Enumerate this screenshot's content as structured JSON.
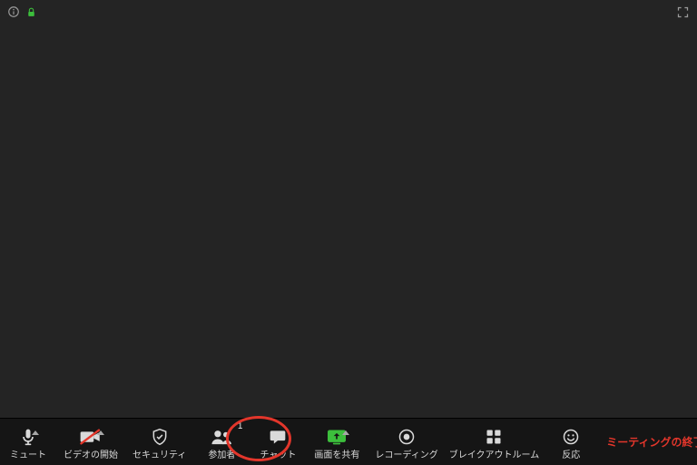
{
  "colors": {
    "accent_green": "#3cbf3c",
    "danger_red": "#e3362b",
    "icon_gray": "#d9d9d9",
    "icon_dim": "#9b9b9b"
  },
  "top": {
    "info_icon": "info-icon",
    "encryption_icon": "lock-icon",
    "fullscreen_icon": "fullscreen-icon"
  },
  "toolbar": {
    "mute": {
      "label": "ミュート"
    },
    "video": {
      "label": "ビデオの開始"
    },
    "security": {
      "label": "セキュリティ"
    },
    "participants": {
      "label": "参加者",
      "count": "1"
    },
    "chat": {
      "label": "チャット"
    },
    "share": {
      "label": "画面を共有"
    },
    "record": {
      "label": "レコーディング"
    },
    "breakout": {
      "label": "ブレイクアウトルーム"
    },
    "reactions": {
      "label": "反応"
    }
  },
  "end_label": "ミーティングの終了",
  "annotation": {
    "target": "participants-button"
  }
}
